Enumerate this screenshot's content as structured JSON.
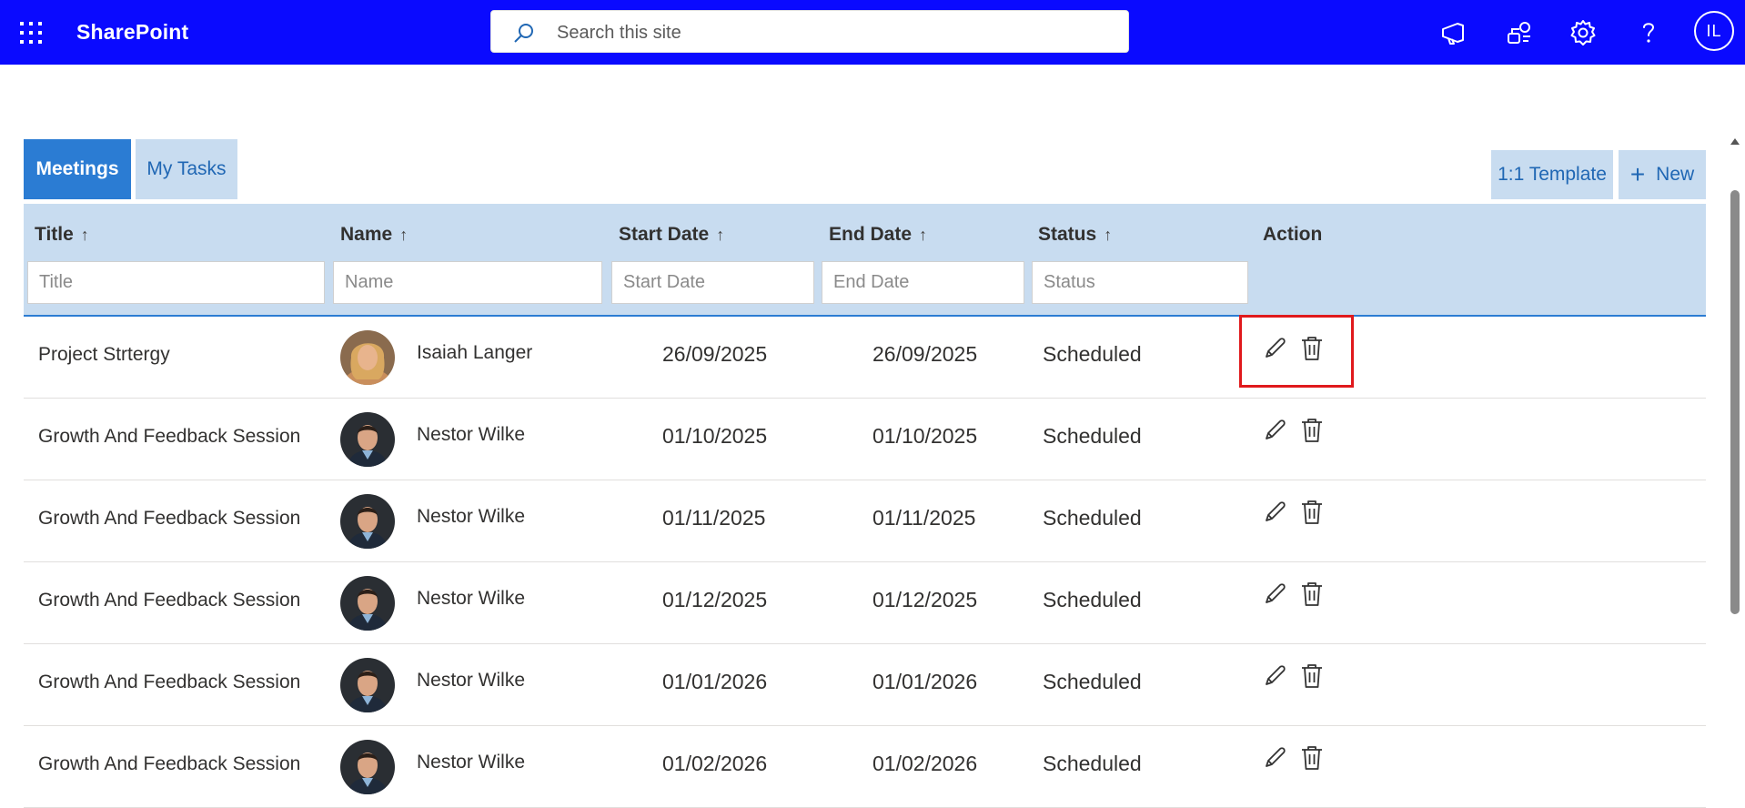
{
  "app": {
    "brand": "SharePoint",
    "user_initials": "IL"
  },
  "search": {
    "placeholder": "Search this site"
  },
  "topbar_icons": [
    "megaphone-icon",
    "share-settings-icon",
    "gear-icon",
    "help-icon"
  ],
  "tabs": [
    {
      "label": "Meetings",
      "active": true
    },
    {
      "label": "My Tasks",
      "active": false
    }
  ],
  "buttons": {
    "template": "1:1 Template",
    "new": "New"
  },
  "table": {
    "columns": [
      {
        "label": "Title",
        "sortable": true,
        "filter_placeholder": "Title"
      },
      {
        "label": "Name",
        "sortable": true,
        "filter_placeholder": "Name"
      },
      {
        "label": "Start Date",
        "sortable": true,
        "filter_placeholder": "Start Date"
      },
      {
        "label": "End Date",
        "sortable": true,
        "filter_placeholder": "End Date"
      },
      {
        "label": "Status",
        "sortable": true,
        "filter_placeholder": "Status"
      },
      {
        "label": "Action",
        "sortable": false
      }
    ],
    "sort_arrow": "↑",
    "rows": [
      {
        "title": "Project Strtergy",
        "name": "Isaiah Langer",
        "avatar": "woman-avatar",
        "start": "26/09/2025",
        "end": "26/09/2025",
        "status": "Scheduled"
      },
      {
        "title": "Growth And Feedback Session",
        "name": "Nestor Wilke",
        "avatar": "man-avatar",
        "start": "01/10/2025",
        "end": "01/10/2025",
        "status": "Scheduled"
      },
      {
        "title": "Growth And Feedback Session",
        "name": "Nestor Wilke",
        "avatar": "man-avatar",
        "start": "01/11/2025",
        "end": "01/11/2025",
        "status": "Scheduled"
      },
      {
        "title": "Growth And Feedback Session",
        "name": "Nestor Wilke",
        "avatar": "man-avatar",
        "start": "01/12/2025",
        "end": "01/12/2025",
        "status": "Scheduled"
      },
      {
        "title": "Growth And Feedback Session",
        "name": "Nestor Wilke",
        "avatar": "man-avatar",
        "start": "01/01/2026",
        "end": "01/01/2026",
        "status": "Scheduled"
      },
      {
        "title": "Growth And Feedback Session",
        "name": "Nestor Wilke",
        "avatar": "man-avatar",
        "start": "01/02/2026",
        "end": "01/02/2026",
        "status": "Scheduled"
      }
    ]
  },
  "colors": {
    "suitebar": "#0a0aff",
    "accent": "#2b7cd3",
    "header_bg": "#c8dcf0",
    "highlight": "#e0191c"
  }
}
